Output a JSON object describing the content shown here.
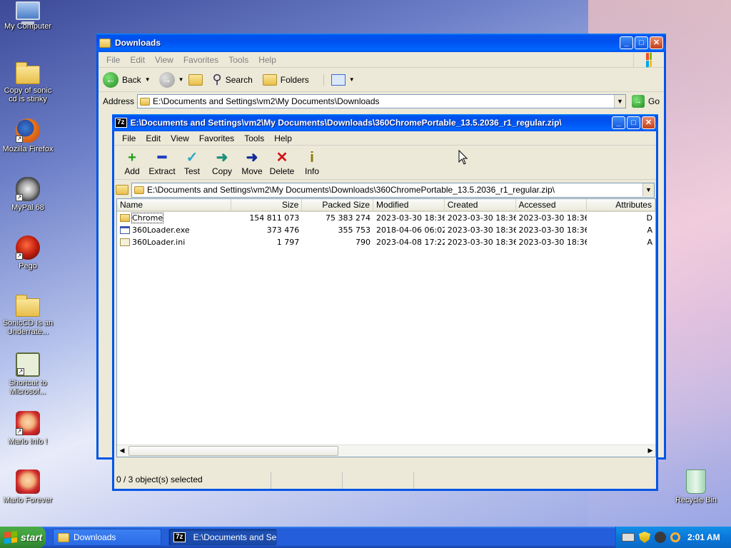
{
  "desktop": {
    "icons": [
      {
        "label": "My Computer"
      },
      {
        "label": "Copy of sonic cd is stinky"
      },
      {
        "label": "Mozilla Firefox"
      },
      {
        "label": "MyPal 68"
      },
      {
        "label": "Pego"
      },
      {
        "label": "SonicCD Is an Underrate..."
      },
      {
        "label": "Shortcut to Microsof..."
      },
      {
        "label": "Mario Info !"
      },
      {
        "label": "Mario Forever"
      },
      {
        "label": "Recycle Bin"
      }
    ]
  },
  "explorer": {
    "title": "Downloads",
    "menu": [
      "File",
      "Edit",
      "View",
      "Favorites",
      "Tools",
      "Help"
    ],
    "toolbar": {
      "back": "Back",
      "search": "Search",
      "folders": "Folders"
    },
    "address_label": "Address",
    "address": "E:\\Documents and Settings\\vm2\\My Documents\\Downloads",
    "go": "Go"
  },
  "sevenzip": {
    "logo": "7z",
    "title": "E:\\Documents and Settings\\vm2\\My Documents\\Downloads\\360ChromePortable_13.5.2036_r1_regular.zip\\",
    "menu": [
      "File",
      "Edit",
      "View",
      "Favorites",
      "Tools",
      "Help"
    ],
    "toolbar": [
      {
        "label": "Add",
        "glyph": "+",
        "color": "#1fa01a"
      },
      {
        "label": "Extract",
        "glyph": "━",
        "color": "#1f3fbf"
      },
      {
        "label": "Test",
        "glyph": "✓",
        "color": "#2aa9c4"
      },
      {
        "label": "Copy",
        "glyph": "➜",
        "color": "#1f8f7a"
      },
      {
        "label": "Move",
        "glyph": "➜",
        "color": "#142a9a"
      },
      {
        "label": "Delete",
        "glyph": "✕",
        "color": "#d01414"
      },
      {
        "label": "Info",
        "glyph": "i",
        "color": "#8a7a00"
      }
    ],
    "path": "E:\\Documents and Settings\\vm2\\My Documents\\Downloads\\360ChromePortable_13.5.2036_r1_regular.zip\\",
    "columns": [
      "Name",
      "Size",
      "Packed Size",
      "Modified",
      "Created",
      "Accessed",
      "Attributes"
    ],
    "rows": [
      {
        "icon": "folder",
        "name": "Chrome",
        "size": "154 811 073",
        "packed": "75 383 274",
        "modified": "2023-03-30 18:36",
        "created": "2023-03-30 18:36",
        "accessed": "2023-03-30 18:36",
        "attr": "D"
      },
      {
        "icon": "exe",
        "name": "360Loader.exe",
        "size": "373 476",
        "packed": "355 753",
        "modified": "2018-04-06 06:02",
        "created": "2023-03-30 18:36",
        "accessed": "2023-03-30 18:36",
        "attr": "A"
      },
      {
        "icon": "ini",
        "name": "360Loader.ini",
        "size": "1 797",
        "packed": "790",
        "modified": "2023-04-08 17:22",
        "created": "2023-03-30 18:36",
        "accessed": "2023-03-30 18:36",
        "attr": "A"
      }
    ],
    "status": "0 / 3 object(s) selected"
  },
  "taskbar": {
    "start": "start",
    "tasks": [
      {
        "label": "Downloads"
      },
      {
        "label": "E:\\Documents and Se..."
      }
    ],
    "clock": "2:01 AM"
  }
}
